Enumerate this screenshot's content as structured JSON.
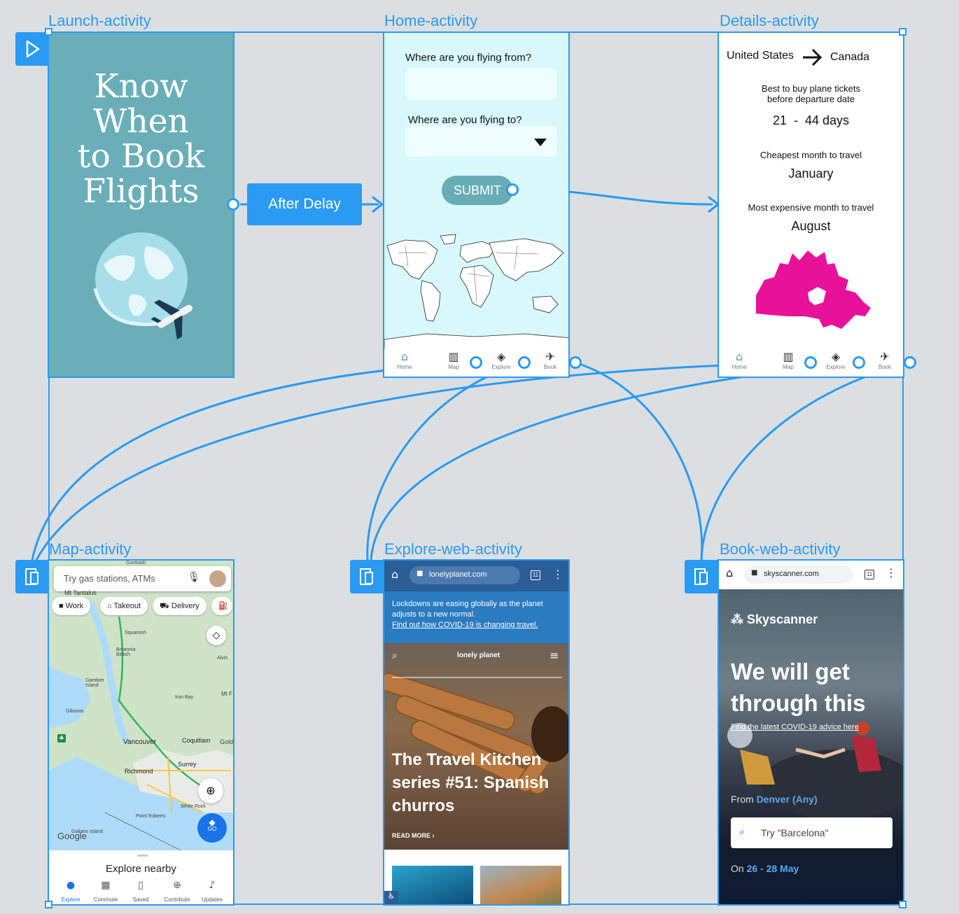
{
  "colors": {
    "accent": "#2b9af3",
    "launch_bg": "#6aaeb8",
    "home_bg": "#d8f8fc",
    "canada": "#e8129a",
    "skyscanner_bg": "#0c1b33",
    "explore_blue": "#2a7bc0"
  },
  "frames": {
    "launch": {
      "label": "Launch-activity",
      "title_lines": [
        "Know",
        "When",
        "to Book",
        "Flights"
      ]
    },
    "home": {
      "label": "Home-activity",
      "from_label": "Where are you flying from?",
      "to_label": "Where are you flying to?",
      "submit": "SUBMIT",
      "tabs": [
        {
          "icon": "home-icon",
          "label": "Home"
        },
        {
          "icon": "map-icon",
          "label": "Map"
        },
        {
          "icon": "compass-icon",
          "label": "Explore"
        },
        {
          "icon": "plane-icon",
          "label": "Book"
        }
      ]
    },
    "details": {
      "label": "Details-activity",
      "from_country": "United States",
      "to_country": "Canada",
      "best_label_1": "Best to buy plane tickets",
      "best_label_2": "before departure date",
      "best_value": "21  -  44 days",
      "cheapest_label": "Cheapest month to travel",
      "cheapest_value": "January",
      "expensive_label": "Most expensive month to travel",
      "expensive_value": "August",
      "tabs": [
        {
          "icon": "home-icon",
          "label": "Home"
        },
        {
          "icon": "map-icon",
          "label": "Map"
        },
        {
          "icon": "compass-icon",
          "label": "Explore"
        },
        {
          "icon": "plane-icon",
          "label": "Book"
        }
      ]
    },
    "map": {
      "label": "Map-activity",
      "search_placeholder": "Try gas stations, ATMs",
      "chips": [
        "Work",
        "Takeout",
        "Delivery"
      ],
      "places": [
        "Garibaldi",
        "Mt Tantalus",
        "Squamish",
        "Britannia Beach",
        "Gambier Island",
        "Gibsons",
        "Iron Bay",
        "Alvin",
        "Vancouver",
        "Coquitlam",
        "Richmond",
        "Surrey",
        "White Rock",
        "Point Roberts",
        "Galiano Island",
        "Gold",
        "Mt F"
      ],
      "google": "Google",
      "go": "GO",
      "explore_nearby": "Explore nearby",
      "nav": [
        "Explore",
        "Commute",
        "Saved",
        "Contribute",
        "Updates"
      ]
    },
    "explore_web": {
      "label": "Explore-web-activity",
      "url": "lonelyplanet.com",
      "tab_count": "11",
      "banner_1": "Lockdowns are easing globally as the planet",
      "banner_2": "adjusts to a new normal.",
      "banner_link": "Find out how COVID-19 is changing travel.",
      "logo": "lonely planet",
      "headline": "The Travel Kitchen series #51: Spanish churros",
      "read_more": "READ MORE"
    },
    "book_web": {
      "label": "Book-web-activity",
      "url": "skyscanner.com",
      "tab_count": "11",
      "brand": "Skyscanner",
      "headline": "We will get through this",
      "link": "Find the latest COVID-19 advice here",
      "from_prefix": "From ",
      "from_value": "Denver (Any)",
      "search_placeholder": "Try \"Barcelona\"",
      "dates_prefix": "On ",
      "dates_value": "26 - 28 May"
    }
  },
  "connector": {
    "label": "After Delay"
  }
}
